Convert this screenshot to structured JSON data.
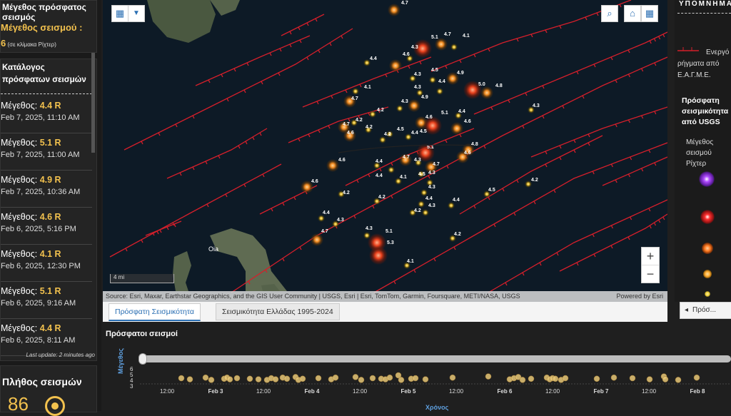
{
  "left": {
    "latest": {
      "title": "Μέγεθος πρόσφατος σεισμός",
      "mag_line": "Μέγεθος σεισμού :",
      "mag_value": "6",
      "scale_note": "(σε κλίμακα Ρίχτερ)"
    },
    "list": {
      "header": "Κατάλογος πρόσφατων σεισμών",
      "items": [
        {
          "prefix": "Μέγεθος: ",
          "mag": "4.4 R",
          "time": "Feb 7, 2025, 11:10 AM"
        },
        {
          "prefix": "Μέγεθος: ",
          "mag": "5.1 R",
          "time": "Feb 7, 2025, 11:00 AM"
        },
        {
          "prefix": "Μέγεθος: ",
          "mag": "4.9 R",
          "time": "Feb 7, 2025, 10:36 AM"
        },
        {
          "prefix": "Μέγεθος: ",
          "mag": "4.6 R",
          "time": "Feb 6, 2025, 5:16 PM"
        },
        {
          "prefix": "Μέγεθος: ",
          "mag": "4.1 R",
          "time": "Feb 6, 2025, 12:30 PM"
        },
        {
          "prefix": "Μέγεθος: ",
          "mag": "5.1 R",
          "time": "Feb 6, 2025, 9:16 AM"
        },
        {
          "prefix": "Μέγεθος: ",
          "mag": "4.4 R",
          "time": "Feb 6, 2025, 8:11 AM"
        }
      ],
      "last_update": "Last update: 2 minutes ago"
    },
    "count": {
      "title": "Πλήθος σεισμών",
      "value": "86"
    }
  },
  "map": {
    "scale": "4 mi",
    "attribution": "Source: Esri, Maxar, Earthstar Geographics, and the GIS User Community | USGS, Esri | Esri, TomTom, Garmin, Foursquare, METI/NASA, USGS",
    "powered": "Powered by Esri",
    "place_label": "Oia",
    "quakes": [
      {
        "mag": 4.7,
        "x": 408,
        "y": 14
      },
      {
        "mag": 5.1,
        "x": 448,
        "y": 68
      },
      {
        "mag": 4.7,
        "x": 474,
        "y": 62
      },
      {
        "mag": 4.1,
        "x": 492,
        "y": 66
      },
      {
        "mag": 4.3,
        "x": 430,
        "y": 82
      },
      {
        "mag": 4.6,
        "x": 410,
        "y": 92
      },
      {
        "mag": 4.4,
        "x": 370,
        "y": 88
      },
      {
        "mag": 4.3,
        "x": 434,
        "y": 110
      },
      {
        "mag": 4.5,
        "x": 462,
        "y": 112
      },
      {
        "mag": 4.9,
        "x": 490,
        "y": 110
      },
      {
        "mag": 4.4,
        "x": 472,
        "y": 128
      },
      {
        "mag": 5.0,
        "x": 518,
        "y": 126
      },
      {
        "mag": 4.8,
        "x": 538,
        "y": 130
      },
      {
        "mag": 4.1,
        "x": 354,
        "y": 128
      },
      {
        "mag": 4.3,
        "x": 444,
        "y": 130
      },
      {
        "mag": 4.9,
        "x": 436,
        "y": 148
      },
      {
        "mag": 4.3,
        "x": 416,
        "y": 152
      },
      {
        "mag": 4.7,
        "x": 346,
        "y": 142
      },
      {
        "mag": 4.2,
        "x": 378,
        "y": 160
      },
      {
        "mag": 4.4,
        "x": 498,
        "y": 162
      },
      {
        "mag": 4.6,
        "x": 446,
        "y": 172
      },
      {
        "mag": 5.1,
        "x": 462,
        "y": 176
      },
      {
        "mag": 4.6,
        "x": 496,
        "y": 180
      },
      {
        "mag": 4.2,
        "x": 352,
        "y": 172
      },
      {
        "mag": 4.7,
        "x": 338,
        "y": 178
      },
      {
        "mag": 4.2,
        "x": 372,
        "y": 182
      },
      {
        "mag": 4.5,
        "x": 402,
        "y": 188
      },
      {
        "mag": 4.4,
        "x": 428,
        "y": 192
      },
      {
        "mag": 4.6,
        "x": 346,
        "y": 190
      },
      {
        "mag": 4.2,
        "x": 392,
        "y": 196
      },
      {
        "mag": 5.1,
        "x": 452,
        "y": 214
      },
      {
        "mag": 4.8,
        "x": 512,
        "y": 210
      },
      {
        "mag": 4.6,
        "x": 504,
        "y": 220
      },
      {
        "mag": 4.7,
        "x": 424,
        "y": 224
      },
      {
        "mag": 4.7,
        "x": 460,
        "y": 234
      },
      {
        "mag": 4.5,
        "x": 446,
        "y": 244
      },
      {
        "mag": 4.4,
        "x": 384,
        "y": 232
      },
      {
        "mag": 4.6,
        "x": 322,
        "y": 232
      },
      {
        "mag": 4.4,
        "x": 404,
        "y": 238
      },
      {
        "mag": 4.3,
        "x": 442,
        "y": 228
      },
      {
        "mag": 4.1,
        "x": 414,
        "y": 254
      },
      {
        "mag": 4.2,
        "x": 596,
        "y": 258
      },
      {
        "mag": 4.6,
        "x": 286,
        "y": 262
      },
      {
        "mag": 4.2,
        "x": 334,
        "y": 272
      },
      {
        "mag": 4.3,
        "x": 458,
        "y": 256
      },
      {
        "mag": 4.4,
        "x": 450,
        "y": 270
      },
      {
        "mag": 4.5,
        "x": 538,
        "y": 272
      },
      {
        "mag": 4.2,
        "x": 384,
        "y": 282
      },
      {
        "mag": 4.4,
        "x": 488,
        "y": 288
      },
      {
        "mag": 4.3,
        "x": 446,
        "y": 286
      },
      {
        "mag": 4.2,
        "x": 434,
        "y": 298
      },
      {
        "mag": 4.3,
        "x": 452,
        "y": 298
      },
      {
        "mag": 4.4,
        "x": 306,
        "y": 306
      },
      {
        "mag": 4.3,
        "x": 326,
        "y": 314
      },
      {
        "mag": 4.7,
        "x": 300,
        "y": 336
      },
      {
        "mag": 4.3,
        "x": 370,
        "y": 330
      },
      {
        "mag": 5.1,
        "x": 384,
        "y": 340
      },
      {
        "mag": 5.3,
        "x": 386,
        "y": 358
      },
      {
        "mag": 4.2,
        "x": 490,
        "y": 334
      },
      {
        "mag": 4.1,
        "x": 426,
        "y": 372
      },
      {
        "mag": 4.3,
        "x": 600,
        "y": 154
      }
    ],
    "labels": [
      {
        "t": "4.7",
        "x": 418,
        "y": 6
      },
      {
        "t": "5.1",
        "x": 460,
        "y": 54
      },
      {
        "t": "4.7",
        "x": 478,
        "y": 50
      },
      {
        "t": "4.1",
        "x": 504,
        "y": 52
      },
      {
        "t": "4.3",
        "x": 432,
        "y": 68
      },
      {
        "t": "4.6",
        "x": 420,
        "y": 78
      },
      {
        "t": "4.4",
        "x": 374,
        "y": 84
      },
      {
        "t": "4.3",
        "x": 436,
        "y": 106
      },
      {
        "t": "4.5",
        "x": 460,
        "y": 100
      },
      {
        "t": "4.9",
        "x": 496,
        "y": 104
      },
      {
        "t": "4.4",
        "x": 470,
        "y": 116
      },
      {
        "t": "5.0",
        "x": 526,
        "y": 120
      },
      {
        "t": "4.8",
        "x": 550,
        "y": 122
      },
      {
        "t": "4.1",
        "x": 366,
        "y": 124
      },
      {
        "t": "4.3",
        "x": 436,
        "y": 124
      },
      {
        "t": "4.9",
        "x": 446,
        "y": 138
      },
      {
        "t": "4.3",
        "x": 418,
        "y": 144
      },
      {
        "t": "4.7",
        "x": 348,
        "y": 140
      },
      {
        "t": "4.2",
        "x": 384,
        "y": 156
      },
      {
        "t": "4.4",
        "x": 498,
        "y": 158
      },
      {
        "t": "4.6",
        "x": 452,
        "y": 166
      },
      {
        "t": "5.1",
        "x": 474,
        "y": 160
      },
      {
        "t": "4.6",
        "x": 506,
        "y": 172
      },
      {
        "t": "4.2",
        "x": 354,
        "y": 170
      },
      {
        "t": "4.7",
        "x": 336,
        "y": 176
      },
      {
        "t": "4.2",
        "x": 368,
        "y": 180
      },
      {
        "t": "4.5",
        "x": 412,
        "y": 183
      },
      {
        "t": "4.4",
        "x": 432,
        "y": 188
      },
      {
        "t": "4.6",
        "x": 342,
        "y": 188
      },
      {
        "t": "4.2",
        "x": 394,
        "y": 190
      },
      {
        "t": "5.1",
        "x": 454,
        "y": 208
      },
      {
        "t": "4.8",
        "x": 516,
        "y": 204
      },
      {
        "t": "4.6",
        "x": 506,
        "y": 216
      },
      {
        "t": "4.7",
        "x": 420,
        "y": 222
      },
      {
        "t": "4.7",
        "x": 462,
        "y": 232
      },
      {
        "t": "4.5",
        "x": 442,
        "y": 246
      },
      {
        "t": "4.4",
        "x": 382,
        "y": 228
      },
      {
        "t": "4.6",
        "x": 330,
        "y": 226
      },
      {
        "t": "4.4",
        "x": 382,
        "y": 248
      },
      {
        "t": "4.3",
        "x": 436,
        "y": 226
      },
      {
        "t": "4.1",
        "x": 416,
        "y": 250
      },
      {
        "t": "4.2",
        "x": 600,
        "y": 254
      },
      {
        "t": "4.6",
        "x": 292,
        "y": 256
      },
      {
        "t": "4.2",
        "x": 336,
        "y": 272
      },
      {
        "t": "4.3",
        "x": 456,
        "y": 264
      },
      {
        "t": "4.4",
        "x": 452,
        "y": 280
      },
      {
        "t": "4.5",
        "x": 540,
        "y": 268
      },
      {
        "t": "4.2",
        "x": 386,
        "y": 278
      },
      {
        "t": "4.4",
        "x": 490,
        "y": 282
      },
      {
        "t": "4.3",
        "x": 456,
        "y": 290
      },
      {
        "t": "4.2",
        "x": 436,
        "y": 297
      },
      {
        "t": "4.3",
        "x": 456,
        "y": 244
      },
      {
        "t": "4.4",
        "x": 308,
        "y": 300
      },
      {
        "t": "4.3",
        "x": 328,
        "y": 310
      },
      {
        "t": "4.7",
        "x": 306,
        "y": 326
      },
      {
        "t": "4.3",
        "x": 368,
        "y": 322
      },
      {
        "t": "5.1",
        "x": 396,
        "y": 326
      },
      {
        "t": "5.3",
        "x": 398,
        "y": 342
      },
      {
        "t": "4.2",
        "x": 492,
        "y": 330
      },
      {
        "t": "4.1",
        "x": 426,
        "y": 368
      },
      {
        "t": "4.3",
        "x": 602,
        "y": 150
      },
      {
        "t": "4.5",
        "x": 444,
        "y": 186
      }
    ]
  },
  "tabs": {
    "recent": "Πρόσφατη Σεισμικότητα",
    "greece": "Σεισμικότητα Ελλάδας 1995-2024"
  },
  "right": {
    "title": "ΥΠΟΜΝΗΜΑ",
    "fault_line1": "Ενεργό",
    "fault_line2": "ρήγματα από",
    "fault_line3": "Ε.Α.Γ.Μ.Ε.",
    "usgs_title": "Πρόσφατη σεισμικότητα από USGS",
    "mag_label": "Μέγεθος σεισμού Ρίχτερ",
    "tab_label": "Πρόσ..."
  },
  "timeline": {
    "title": "Πρόσφατοι σεισμοί",
    "ylabel": "Μέγεθος",
    "xlabel": "Χρόνος",
    "yticks": [
      "6",
      "5",
      "4",
      "3"
    ],
    "xticks": [
      "12:00",
      "Feb 3",
      "12:00",
      "Feb 4",
      "12:00",
      "Feb 5",
      "12:00",
      "Feb 6",
      "12:00",
      "Feb 7",
      "12:00",
      "Feb 8"
    ],
    "dots": [
      {
        "x": 58,
        "y": 4.5
      },
      {
        "x": 70,
        "y": 4.3
      },
      {
        "x": 92,
        "y": 4.6
      },
      {
        "x": 100,
        "y": 4.2
      },
      {
        "x": 118,
        "y": 4.4
      },
      {
        "x": 122,
        "y": 4.6
      },
      {
        "x": 126,
        "y": 4.3
      },
      {
        "x": 136,
        "y": 4.5
      },
      {
        "x": 154,
        "y": 4.4
      },
      {
        "x": 166,
        "y": 4.3
      },
      {
        "x": 178,
        "y": 4.2
      },
      {
        "x": 184,
        "y": 4.5
      },
      {
        "x": 190,
        "y": 4.3
      },
      {
        "x": 200,
        "y": 4.6
      },
      {
        "x": 206,
        "y": 4.4
      },
      {
        "x": 218,
        "y": 4.7
      },
      {
        "x": 222,
        "y": 4.2
      },
      {
        "x": 228,
        "y": 4.4
      },
      {
        "x": 250,
        "y": 4.5
      },
      {
        "x": 268,
        "y": 4.3
      },
      {
        "x": 274,
        "y": 4.6
      },
      {
        "x": 302,
        "y": 4.7
      },
      {
        "x": 310,
        "y": 4.2
      },
      {
        "x": 326,
        "y": 4.5
      },
      {
        "x": 338,
        "y": 4.4
      },
      {
        "x": 344,
        "y": 4.3
      },
      {
        "x": 350,
        "y": 4.6
      },
      {
        "x": 362,
        "y": 5.0
      },
      {
        "x": 366,
        "y": 4.2
      },
      {
        "x": 380,
        "y": 4.4
      },
      {
        "x": 386,
        "y": 4.5
      },
      {
        "x": 400,
        "y": 4.3
      },
      {
        "x": 438,
        "y": 4.6
      },
      {
        "x": 488,
        "y": 4.8
      },
      {
        "x": 518,
        "y": 4.3
      },
      {
        "x": 524,
        "y": 4.5
      },
      {
        "x": 530,
        "y": 4.7
      },
      {
        "x": 536,
        "y": 4.2
      },
      {
        "x": 548,
        "y": 4.4
      },
      {
        "x": 570,
        "y": 4.6
      },
      {
        "x": 574,
        "y": 4.3
      },
      {
        "x": 578,
        "y": 4.5
      },
      {
        "x": 582,
        "y": 4.4
      },
      {
        "x": 590,
        "y": 4.2
      },
      {
        "x": 596,
        "y": 4.5
      },
      {
        "x": 640,
        "y": 4.4
      },
      {
        "x": 664,
        "y": 4.6
      },
      {
        "x": 690,
        "y": 4.5
      },
      {
        "x": 714,
        "y": 4.3
      },
      {
        "x": 734,
        "y": 4.8
      },
      {
        "x": 736,
        "y": 4.3
      },
      {
        "x": 754,
        "y": 4.2
      },
      {
        "x": 780,
        "y": 4.6
      },
      {
        "x": 876,
        "y": 4.9
      }
    ]
  },
  "colors": {
    "accent": "#f2c14e",
    "fault": "#d41f2b",
    "sea": "#0d1a26",
    "tab_active": "#2b6fb3"
  }
}
